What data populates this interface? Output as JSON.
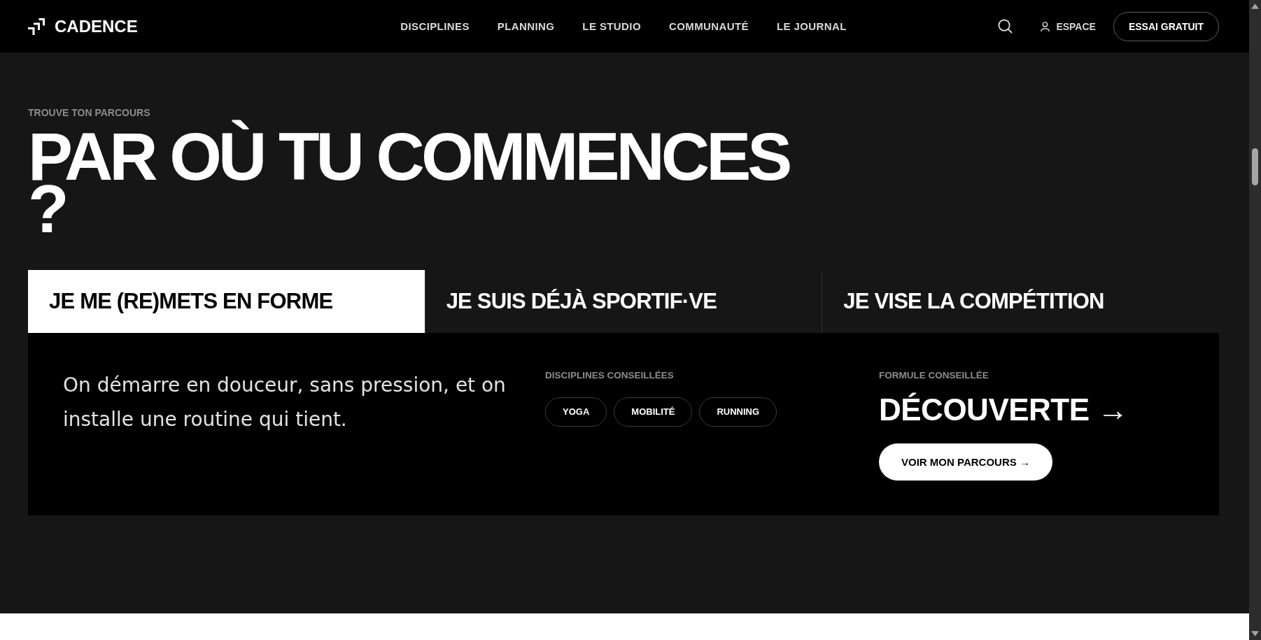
{
  "header": {
    "logo": "CADENCE",
    "nav": [
      "DISCIPLINES",
      "PLANNING",
      "LE STUDIO",
      "COMMUNAUTÉ",
      "LE JOURNAL"
    ],
    "account": "ESPACE",
    "cta": "ESSAI GRATUIT"
  },
  "intro": {
    "eyebrow": "TROUVE TON PARCOURS",
    "title": "PAR OÙ TU COMMENCES ?"
  },
  "tabs": [
    {
      "label": "JE ME (RE)METS EN FORME",
      "selected": true
    },
    {
      "label": "JE SUIS DÉJÀ SPORTIF·VE",
      "selected": false
    },
    {
      "label": "JE VISE LA COMPÉTITION",
      "selected": false
    }
  ],
  "panel": {
    "description": "On démarre en douceur, sans pression, et on installe une routine qui tient.",
    "disciplines": {
      "label": "DISCIPLINES CONSEILLÉES",
      "tags": [
        "YOGA",
        "MOBILITÉ",
        "RUNNING"
      ]
    },
    "formula": {
      "label": "FORMULE CONSEILLÉE",
      "name": "DÉCOUVERTE →",
      "button": "VOIR MON PARCOURS →"
    }
  }
}
